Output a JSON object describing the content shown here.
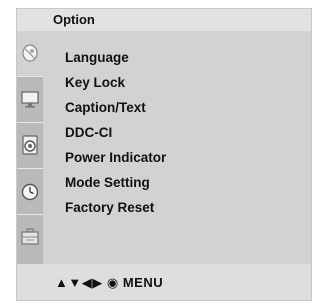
{
  "osd": {
    "title": "Option",
    "menu_items": [
      "Language",
      "Key Lock",
      "Caption/Text",
      "DDC-CI",
      "Power Indicator",
      "Mode Setting",
      "Factory Reset"
    ],
    "sidebar_icons": [
      "satellite-dish-icon",
      "monitor-icon",
      "speaker-icon",
      "clock-icon",
      "toolbox-icon"
    ],
    "active_icon_index": 0,
    "footer": {
      "nav_arrows": "▲▼◀▶",
      "menu_symbol": "◉",
      "menu_label": "MENU"
    }
  }
}
